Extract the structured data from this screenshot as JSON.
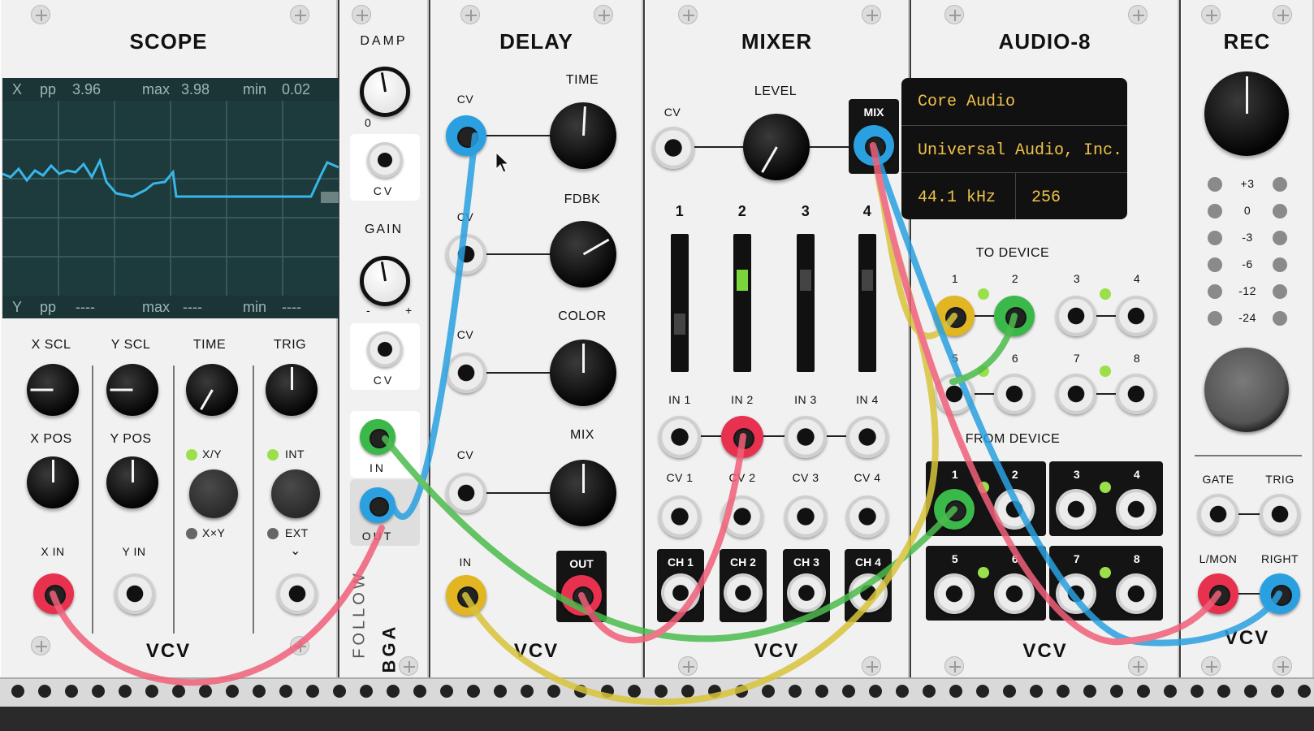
{
  "brand": "VCV",
  "modules": {
    "scope": {
      "title": "SCOPE",
      "x_stats": {
        "axis": "X",
        "pp_label": "pp",
        "pp": "3.96",
        "max_label": "max",
        "max": "3.98",
        "min_label": "min",
        "min": "0.02"
      },
      "y_stats": {
        "axis": "Y",
        "pp_label": "pp",
        "pp": "----",
        "max_label": "max",
        "max": "----",
        "min_label": "min",
        "min": "----"
      },
      "labels": {
        "x_scl": "X SCL",
        "y_scl": "Y SCL",
        "time": "TIME",
        "trig": "TRIG",
        "x_pos": "X POS",
        "y_pos": "Y POS",
        "xy": "X/Y",
        "xxy": "X×Y",
        "int": "INT",
        "ext": "EXT",
        "x_in": "X IN",
        "y_in": "Y IN"
      },
      "trace_color": "#38b6e8"
    },
    "follow": {
      "title": "FOLLOW",
      "vendor": "BGA",
      "labels": {
        "damp": "DAMP",
        "damp_min": "0",
        "cv1": "CV",
        "gain": "GAIN",
        "gain_minus": "-",
        "gain_plus": "+",
        "cv2": "CV",
        "in": "IN",
        "out": "OUT"
      }
    },
    "delay": {
      "title": "DELAY",
      "labels": {
        "cv": "CV",
        "time": "TIME",
        "fdbk": "FDBK",
        "color": "COLOR",
        "mix": "MIX",
        "in": "IN",
        "out": "OUT"
      }
    },
    "mixer": {
      "title": "MIXER",
      "labels": {
        "cv": "CV",
        "level": "LEVEL",
        "mix": "MIX"
      },
      "channels": [
        {
          "num": "1",
          "in": "IN 1",
          "cv": "CV 1",
          "ch": "CH 1"
        },
        {
          "num": "2",
          "in": "IN 2",
          "cv": "CV 2",
          "ch": "CH 2"
        },
        {
          "num": "3",
          "in": "IN 3",
          "cv": "CV 3",
          "ch": "CH 3"
        },
        {
          "num": "4",
          "in": "IN 4",
          "cv": "CV 4",
          "ch": "CH 4"
        }
      ]
    },
    "audio8": {
      "title": "AUDIO-8",
      "driver": "Core Audio",
      "device": "Universal Audio, Inc.",
      "sample_rate": "44.1 kHz",
      "block_size": "256",
      "to_device": "TO DEVICE",
      "from_device": "FROM DEVICE",
      "ports": [
        "1",
        "2",
        "3",
        "4",
        "5",
        "6",
        "7",
        "8"
      ]
    },
    "rec": {
      "title": "REC",
      "levels": [
        "+3",
        "0",
        "-3",
        "-6",
        "-12",
        "-24"
      ],
      "labels": {
        "gate": "GATE",
        "trig": "TRIG",
        "lmon": "L/MON",
        "right": "RIGHT"
      }
    }
  },
  "colors": {
    "cable_red": "#f0607a",
    "cable_blue": "#2aa0e0",
    "cable_green": "#4cbb4c",
    "cable_yellow": "#d8c43a",
    "display_text": "#f0c24b",
    "led_green": "#9be04a"
  }
}
